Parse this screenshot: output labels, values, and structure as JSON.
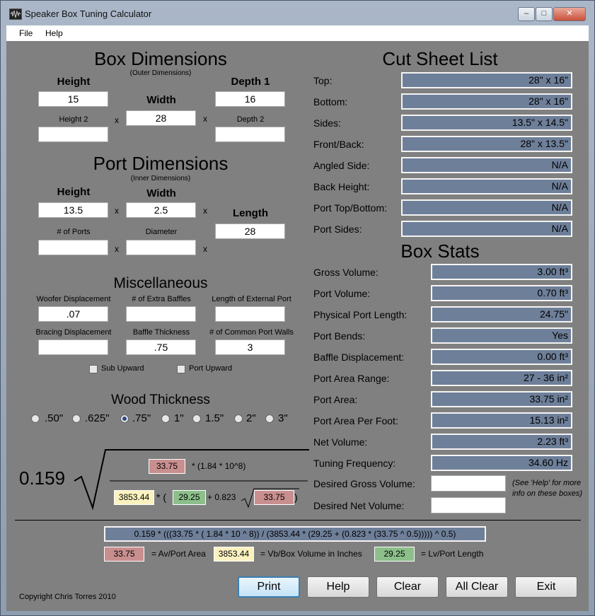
{
  "window": {
    "title": "Speaker Box Tuning Calculator",
    "controls": [
      "–",
      "□",
      "✕"
    ]
  },
  "menu": [
    "File",
    "Help"
  ],
  "box_dimensions": {
    "heading": "Box Dimensions",
    "subheading": "(Outer Dimensions)",
    "height_label": "Height",
    "height_value": "15",
    "width_label": "Width",
    "width_value": "28",
    "depth1_label": "Depth 1",
    "depth1_value": "16",
    "height2_label": "Height 2",
    "height2_value": "",
    "depth2_label": "Depth 2",
    "depth2_value": "",
    "x": "x"
  },
  "port_dimensions": {
    "heading": "Port Dimensions",
    "subheading": "(Inner Dimensions)",
    "height_label": "Height",
    "height_value": "13.5",
    "width_label": "Width",
    "width_value": "2.5",
    "length_label": "Length",
    "length_value": "28",
    "ports_label": "# of Ports",
    "ports_value": "",
    "diameter_label": "Diameter",
    "diameter_value": ""
  },
  "misc": {
    "heading": "Miscellaneous",
    "woofer_label": "Woofer Displacement",
    "woofer_value": ".07",
    "extra_baffles_label": "# of Extra Baffles",
    "extra_baffles_value": "",
    "ext_port_label": "Length of External Port",
    "ext_port_value": "",
    "bracing_label": "Bracing Displacement",
    "bracing_value": "",
    "baffle_thickness_label": "Baffle Thickness",
    "baffle_thickness_value": ".75",
    "common_walls_label": "# of Common Port Walls",
    "common_walls_value": "3",
    "sub_upward": "Sub Upward",
    "port_upward": "Port Upward"
  },
  "wood": {
    "heading": "Wood Thickness",
    "options": [
      ".50\"",
      ".625\"",
      ".75\"",
      "1\"",
      "1.5\"",
      "2\"",
      "3\""
    ],
    "selected": ".75\""
  },
  "cut_sheet": {
    "heading": "Cut Sheet List",
    "rows": [
      {
        "label": "Top:",
        "value": "28\" x 16\""
      },
      {
        "label": "Bottom:",
        "value": "28\" x 16\""
      },
      {
        "label": "Sides:",
        "value": "13.5\" x 14.5\""
      },
      {
        "label": "Front/Back:",
        "value": "28\" x 13.5\""
      },
      {
        "label": "Angled Side:",
        "value": "N/A"
      },
      {
        "label": "Back Height:",
        "value": "N/A"
      },
      {
        "label": "Port Top/Bottom:",
        "value": "N/A"
      },
      {
        "label": "Port Sides:",
        "value": "N/A"
      }
    ]
  },
  "box_stats": {
    "heading": "Box Stats",
    "rows": [
      {
        "label": "Gross Volume:",
        "value": "3.00 ft³"
      },
      {
        "label": "Port Volume:",
        "value": "0.70 ft³"
      },
      {
        "label": "Physical Port Length:",
        "value": "24.75\""
      },
      {
        "label": "Port Bends:",
        "value": "Yes"
      },
      {
        "label": "Baffle Displacement:",
        "value": "0.00 ft³"
      },
      {
        "label": "Port Area Range:",
        "value": "27 - 36 in²"
      },
      {
        "label": "Port Area:",
        "value": "33.75 in²"
      },
      {
        "label": "Port Area Per Foot:",
        "value": "15.13 in²"
      },
      {
        "label": "Net Volume:",
        "value": "2.23 ft³"
      },
      {
        "label": "Tuning Frequency:",
        "value": "34.60 Hz"
      }
    ],
    "desired_gross_label": "Desired Gross Volume:",
    "desired_gross_value": "",
    "desired_net_label": "Desired Net Volume:",
    "desired_net_value": "",
    "help_note": "(See 'Help' for more info on these boxes)"
  },
  "formula": {
    "const": "0.159",
    "av": "33.75",
    "numerator_tail": "* (1.84 * 10^8)",
    "vb": "3853.44",
    "star_paren": "* (",
    "lv": "29.25",
    "plus": "+ 0.823",
    "close": ")",
    "full": "0.159 * (((33.75 * ( 1.84 * 10 ^ 8)) / (3853.44 * (29.25 + (0.823 * (33.75 ^ 0.5))))) ^ 0.5)"
  },
  "legend": {
    "av_value": "33.75",
    "av_text": "= Av/Port Area",
    "vb_value": "3853.44",
    "vb_text": "= Vb/Box Volume in Inches",
    "lv_value": "29.25",
    "lv_text": "= Lv/Port Length"
  },
  "buttons": [
    "Print",
    "Help",
    "Clear",
    "All Clear",
    "Exit"
  ],
  "copyright": "Copyright Chris Torres 2010",
  "colors": {
    "panel": "#808080",
    "result_box": "#6e7f99",
    "av_box": "#c98f8f",
    "vb_box": "#fbf2c0",
    "lv_box": "#8cbf8a"
  }
}
